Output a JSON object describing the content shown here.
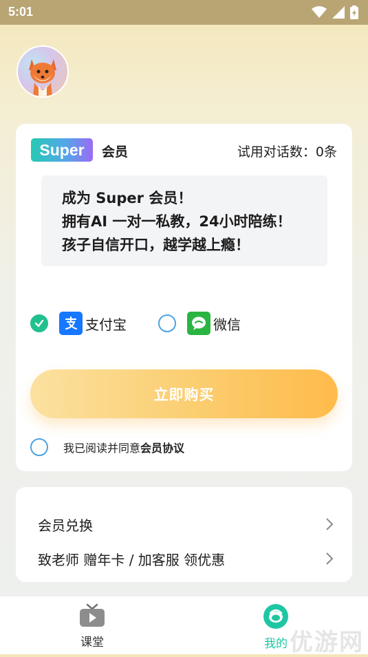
{
  "status_bar": {
    "time": "5:01"
  },
  "member_card": {
    "badge": "Super",
    "label": "会员",
    "trial_count": "试用对话数：0条",
    "promo_lines": [
      "成为 Super 会员！",
      "拥有AI 一对一私教，24小时陪练！",
      "孩子自信开口，越学越上瘾！"
    ],
    "payment": {
      "alipay_label": "支付宝",
      "alipay_selected": true,
      "wechat_label": "微信",
      "wechat_selected": false
    },
    "buy_button_label": "立即购买",
    "agreement": {
      "prefix": "我已阅读并同意",
      "link": "会员协议",
      "checked": false
    }
  },
  "menu": {
    "items": [
      {
        "label": "会员兑换"
      },
      {
        "label": "致老师 赠年卡 / 加客服 领优惠"
      }
    ]
  },
  "bottom_nav": {
    "items": [
      {
        "label": "课堂",
        "active": false,
        "icon": "tv-icon"
      },
      {
        "label": "我的",
        "active": true,
        "icon": "profile-icon"
      }
    ],
    "active_color": "#1fc6a4"
  },
  "watermark": "优游网"
}
